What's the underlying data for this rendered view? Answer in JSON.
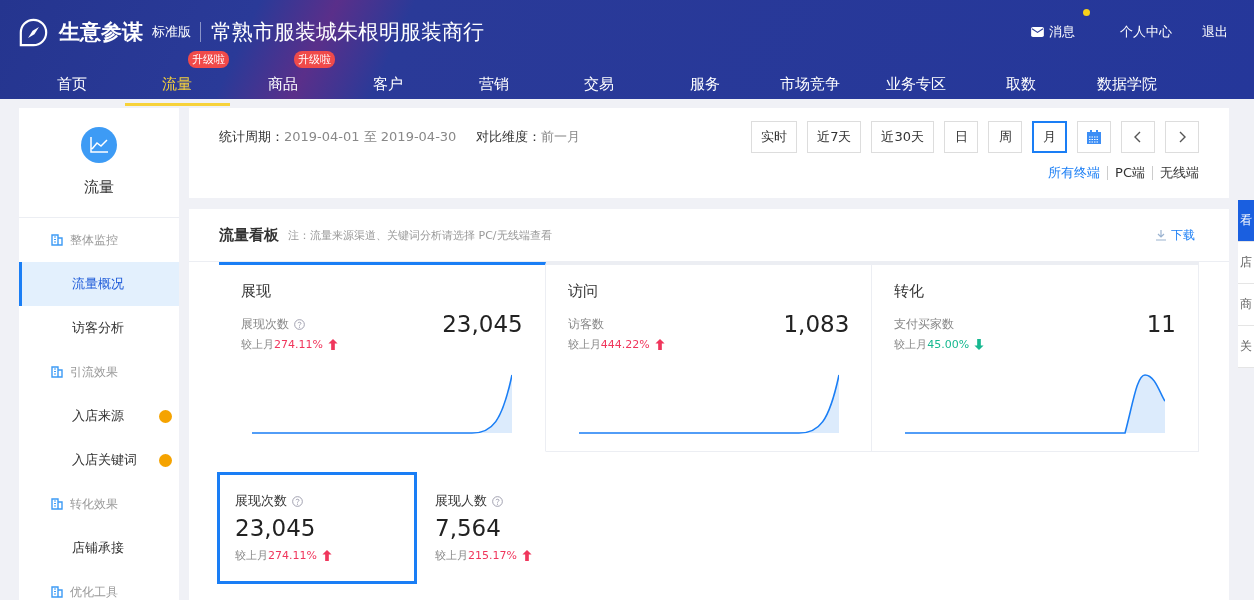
{
  "header": {
    "app_name": "生意参谋",
    "edition": "标准版",
    "shop_name": "常熟市服装城朱根明服装商行",
    "links": [
      {
        "label": "消息",
        "kind": "message",
        "unread": true
      },
      {
        "label": "个人中心",
        "kind": "plain"
      },
      {
        "label": "退出",
        "kind": "plain"
      }
    ],
    "nav": [
      {
        "label": "首页",
        "selected": false
      },
      {
        "label": "流量",
        "selected": true,
        "badge": "升级啦"
      },
      {
        "label": "商品",
        "selected": false,
        "badge": "升级啦"
      },
      {
        "label": "客户",
        "selected": false
      },
      {
        "label": "营销",
        "selected": false
      },
      {
        "label": "交易",
        "selected": false
      },
      {
        "label": "服务",
        "selected": false
      },
      {
        "label": "市场竞争",
        "selected": false
      },
      {
        "label": "业务专区",
        "selected": false
      },
      {
        "label": "取数",
        "selected": false
      },
      {
        "label": "数据学院",
        "selected": false
      }
    ]
  },
  "sidebar": {
    "title": "流量",
    "groups": [
      {
        "label": "整体监控",
        "children": [
          {
            "label": "流量概况",
            "selected": true,
            "dot": false
          },
          {
            "label": "访客分析",
            "selected": false,
            "dot": false
          }
        ]
      },
      {
        "label": "引流效果",
        "children": [
          {
            "label": "入店来源",
            "selected": false,
            "dot": true
          },
          {
            "label": "入店关键词",
            "selected": false,
            "dot": true
          }
        ]
      },
      {
        "label": "转化效果",
        "children": [
          {
            "label": "店铺承接",
            "selected": false,
            "dot": false
          }
        ]
      },
      {
        "label": "优化工具"
      }
    ]
  },
  "period": {
    "label": "统计周期：",
    "value": "2019-04-01 至 2019-04-30",
    "compare_label": "对比维度：",
    "compare_value": "前一月",
    "ranges": [
      {
        "label": "实时",
        "kind": "text",
        "selected": false
      },
      {
        "label": "近7天",
        "kind": "text",
        "selected": false
      },
      {
        "label": "近30天",
        "kind": "text",
        "selected": false
      },
      {
        "label": "日",
        "kind": "text",
        "selected": false
      },
      {
        "label": "周",
        "kind": "text",
        "selected": false
      },
      {
        "label": "月",
        "kind": "text",
        "selected": true
      },
      {
        "kind": "calendar",
        "selected": false
      },
      {
        "kind": "prev",
        "selected": false
      },
      {
        "kind": "next",
        "selected": false
      }
    ],
    "terminals": [
      {
        "label": "所有终端",
        "selected": true
      },
      {
        "label": "PC端",
        "selected": false
      },
      {
        "label": "无线端",
        "selected": false
      }
    ]
  },
  "board": {
    "title": "流量看板",
    "note": "注：流量来源渠道、关键词分析请选择 PC/无线端查看",
    "download": "下载",
    "cards": [
      {
        "title": "展现",
        "metric": "展现次数",
        "help": true,
        "value": "23,045",
        "compare": "较上月",
        "change": "274.11%",
        "rising": true,
        "kind": "rise",
        "selected": true
      },
      {
        "title": "访问",
        "metric": "访客数",
        "help": false,
        "value": "1,083",
        "compare": "较上月",
        "change": "444.22%",
        "rising": true,
        "kind": "rise",
        "selected": false
      },
      {
        "title": "转化",
        "metric": "支付买家数",
        "help": false,
        "value": "11",
        "compare": "较上月",
        "change": "45.00%",
        "rising": false,
        "kind": "peak",
        "selected": false
      }
    ],
    "details": [
      {
        "metric": "展现次数",
        "help": true,
        "value": "23,045",
        "compare": "较上月",
        "change": "274.11%",
        "rising": true,
        "selected": true
      },
      {
        "metric": "展现人数",
        "help": true,
        "value": "7,564",
        "compare": "较上月",
        "change": "215.17%",
        "rising": true,
        "selected": false
      }
    ]
  },
  "side_tabs": [
    {
      "label": "看",
      "selected": true
    },
    {
      "label": "店",
      "selected": false
    },
    {
      "label": "商",
      "selected": false
    },
    {
      "label": "关",
      "selected": false
    }
  ]
}
